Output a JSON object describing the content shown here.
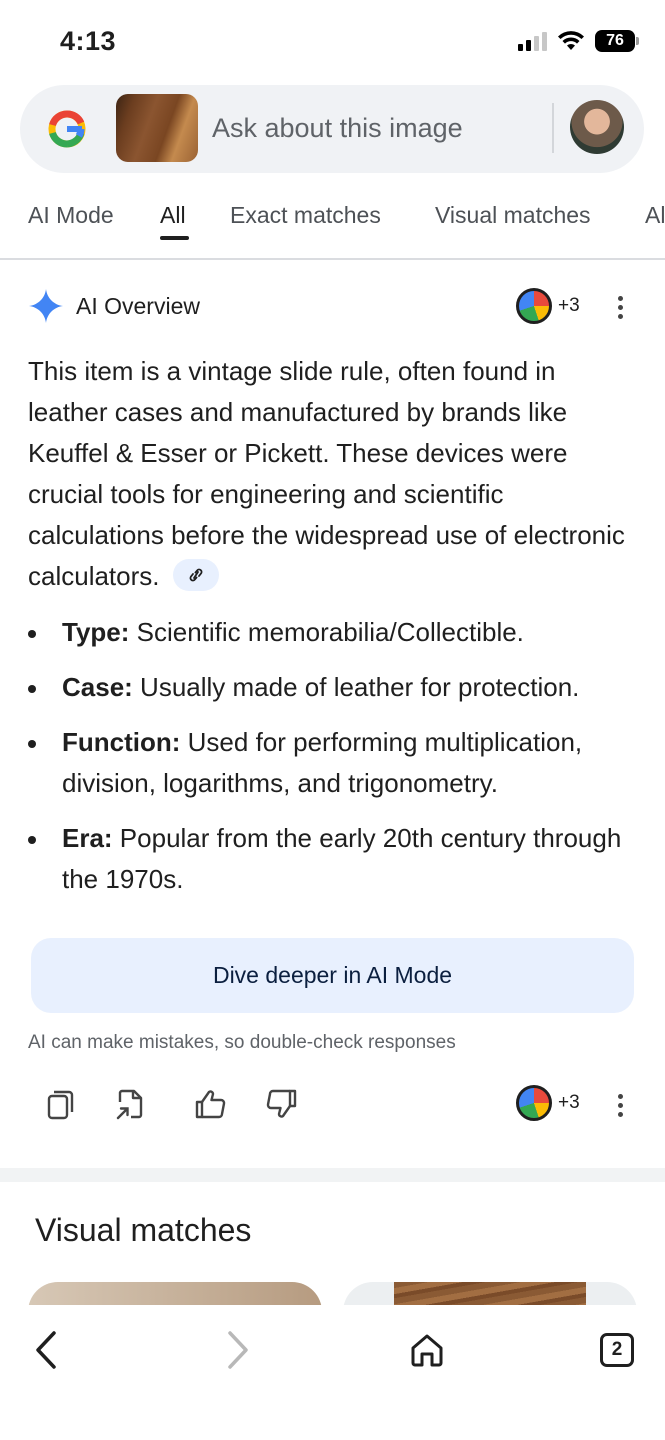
{
  "status_bar": {
    "time": "4:13",
    "battery": "76"
  },
  "search": {
    "placeholder": "Ask about this image"
  },
  "tabs": [
    {
      "label": "AI Mode",
      "active": false
    },
    {
      "label": "All",
      "active": true
    },
    {
      "label": "Exact matches",
      "active": false
    },
    {
      "label": "Visual matches",
      "active": false
    },
    {
      "label": "Al",
      "active": false
    }
  ],
  "ai_overview": {
    "title": "AI Overview",
    "sources_count": "+3",
    "paragraph": "This item is a vintage slide rule, often found in leather cases and manufactured by brands like Keuffel & Esser or Pickett. These devices were crucial tools for engineering and scientific calculations before the widespread use of electronic calculators.",
    "bullets": [
      {
        "term": "Type:",
        "text": " Scientific memorabilia/Collectible."
      },
      {
        "term": "Case:",
        "text": " Usually made of leather for protection."
      },
      {
        "term": "Function:",
        "text": " Used for performing multiplication, division, logarithms, and trigonometry."
      },
      {
        "term": "Era:",
        "text": " Popular from the early 20th century through the 1970s."
      }
    ],
    "dive_button": "Dive deeper in AI Mode",
    "disclaimer": "AI can make mistakes, so double-check responses",
    "footer_sources_count": "+3"
  },
  "visual_matches": {
    "title": "Visual matches"
  },
  "bottom_nav": {
    "tab_count": "2"
  },
  "colors": {
    "accent_blue": "#4285f4",
    "chip_bg": "#e8f0fe"
  }
}
